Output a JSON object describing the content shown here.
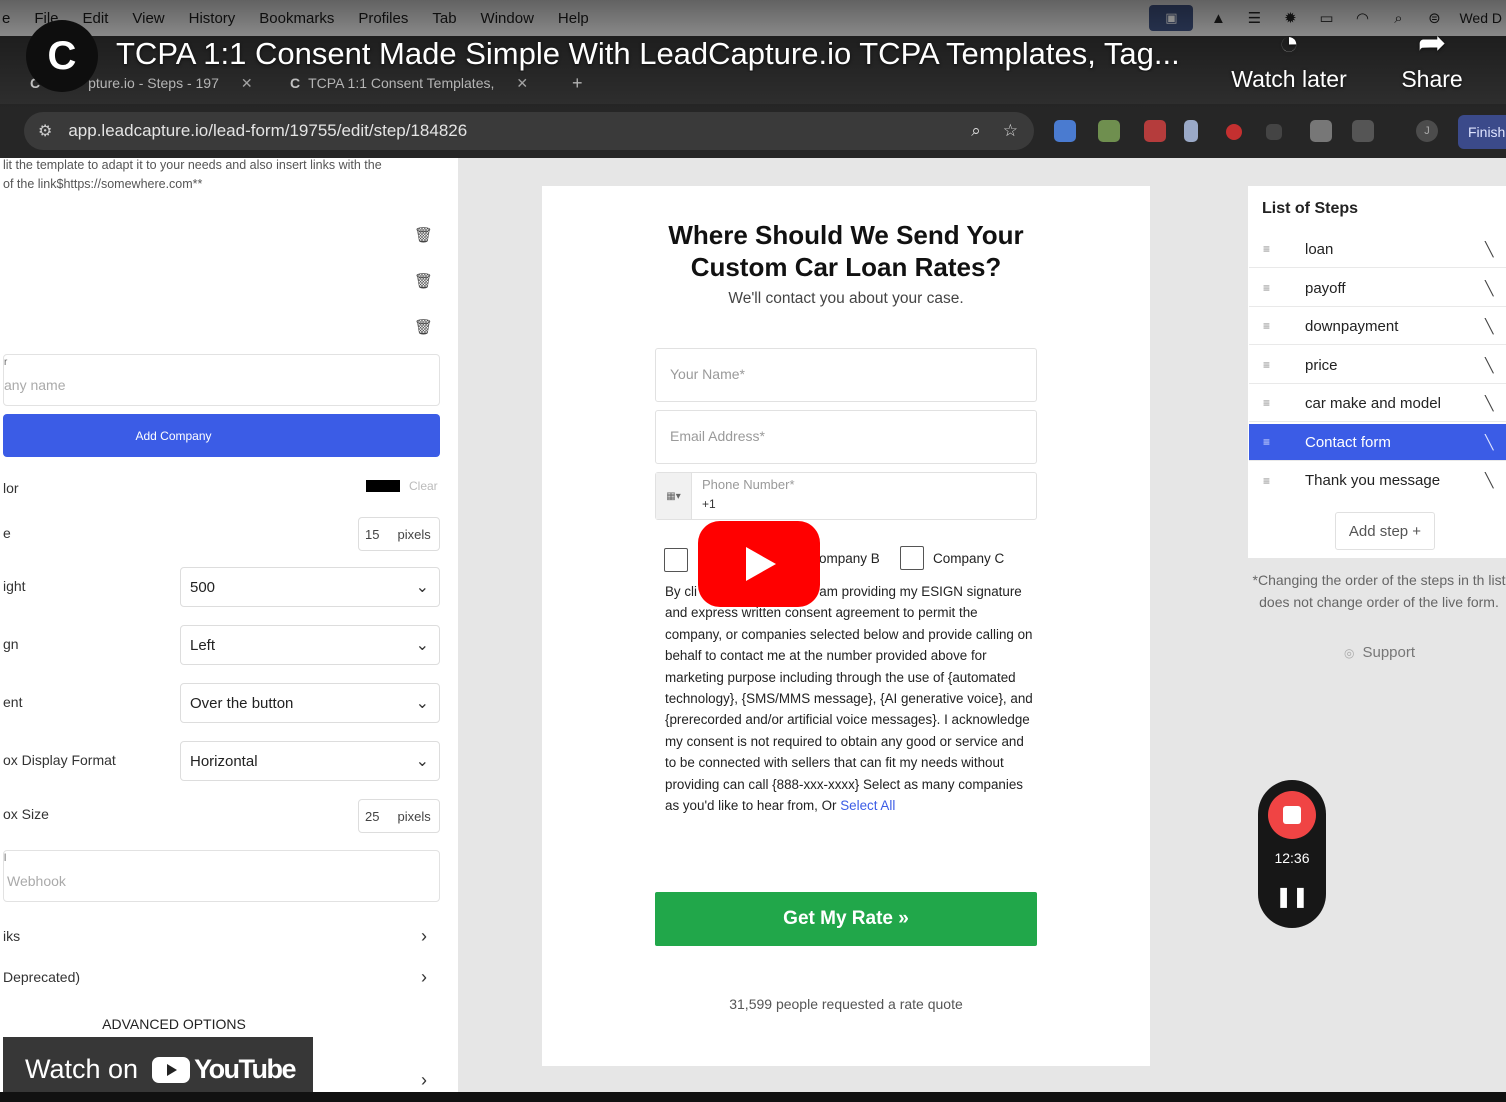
{
  "menubar": {
    "app": "e",
    "items": [
      "File",
      "Edit",
      "View",
      "History",
      "Bookmarks",
      "Profiles",
      "Tab",
      "Window",
      "Help"
    ],
    "clock": "Wed D"
  },
  "browser": {
    "tabs": [
      {
        "title": "pture.io - Steps - 197"
      },
      {
        "title": "TCPA 1:1 Consent Templates,"
      }
    ],
    "new_tab": "+",
    "url": "app.leadcapture.io/lead-form/19755/edit/step/184826",
    "finish_label": "Finish",
    "profile_initial": "J"
  },
  "youtube": {
    "title": "TCPA 1:1 Consent Made Simple With LeadCapture.io TCPA Templates, Tag...",
    "watch_later": "Watch later",
    "share": "Share",
    "watch_on": "Watch on",
    "youtube_word": "YouTube"
  },
  "left_panel": {
    "hint_line1": "lit the template to adapt it to your needs and also insert links with the",
    "hint_line2": "of the link$https://somewhere.com**",
    "company_label_fragment": "r",
    "company_placeholder": "any name",
    "add_company": "Add Company",
    "color_label": "lor",
    "clear": "Clear",
    "size_label": "e",
    "size_value": "15",
    "size_unit": "pixels",
    "weight_label": "ight",
    "weight_value": "500",
    "align_label": "gn",
    "align_value": "Left",
    "placement_label": "ent",
    "placement_value": "Over the button",
    "display_format_label": "ox Display Format",
    "display_format_value": "Horizontal",
    "box_size_label": "ox Size",
    "box_size_value": "25",
    "box_size_unit": "pixels",
    "webhook_label": "l",
    "webhook_placeholder": "Webhook",
    "links_label": "iks",
    "deprecated_label": "Deprecated)",
    "advanced": "ADVANCED OPTIONS"
  },
  "form": {
    "heading_line1": "Where Should We Send Your",
    "heading_line2": "Custom Car Loan Rates?",
    "subheading": "We'll contact you about your case.",
    "name_placeholder": "Your Name*",
    "email_placeholder": "Email Address*",
    "phone_placeholder": "Phone Number*",
    "phone_prefix": "+1",
    "company_b": "ompany B",
    "company_c": "Company C",
    "legal_text": "By cli          h CTA Text} below I am providing my ESIGN signature and express written consent agreement to permit the company, or companies selected below and provide calling on behalf to contact me at the number provided above for marketing purpose including through the use of {automated technology}, {SMS/MMS message}, {AI generative voice}, and {prerecorded and/or artificial voice messages}. I acknowledge my consent is not required to obtain any good or service and to be connected with sellers that can fit my needs without providing can call {888-xxx-xxxx} Select as many companies as you'd like to hear from, Or",
    "select_all": "Select All",
    "cta": "Get My Rate »",
    "social_proof": "31,599 people requested a rate quote"
  },
  "steps_panel": {
    "title": "List of Steps",
    "steps": [
      "loan",
      "payoff",
      "downpayment",
      "price",
      "car make and model",
      "Contact form",
      "Thank you message"
    ],
    "active_index": 5,
    "add_step": "Add step +",
    "note": "*Changing the order of the steps in th list does not change order of the live form.",
    "support": "Support"
  },
  "recorder": {
    "time": "12:36"
  },
  "colors": {
    "accent_blue": "#3b5ce6",
    "cta_green": "#21a74a",
    "youtube_red": "#ff0000",
    "record_red": "#f04444"
  }
}
